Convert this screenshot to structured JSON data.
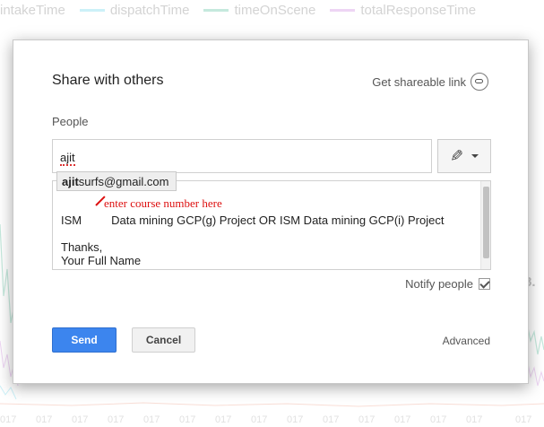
{
  "background": {
    "legend": [
      {
        "label": "intakeTime",
        "color": "#9e9e9e"
      },
      {
        "label": "dispatchTime",
        "color": "#8fe0f0"
      },
      {
        "label": "timeOnScene",
        "color": "#7fcfb4"
      },
      {
        "label": "totalResponseTime",
        "color": "#d9a3e6"
      }
    ],
    "right_label": "8.",
    "x_tick_labels": [
      "017",
      "017",
      "017",
      "017",
      "017",
      "017",
      "017",
      "017",
      "017",
      "017",
      "017",
      "017",
      "017",
      "017",
      "017"
    ]
  },
  "dialog": {
    "title": "Share with others",
    "share_link_label": "Get shareable link",
    "people_label": "People",
    "people_input_value": "ajit",
    "suggestion": {
      "bold": "ajit",
      "rest": "surfs@gmail.com"
    },
    "annotation": "enter course number here",
    "message": {
      "line1_prefix": "ISM",
      "line1_rest": "Data mining GCP(g) Project OR ISM Data mining GCP(i) Project",
      "line2": "Thanks,",
      "line3": "Your Full Name"
    },
    "notify_label": "Notify people",
    "notify_checked": true,
    "send_label": "Send",
    "cancel_label": "Cancel",
    "advanced_label": "Advanced"
  },
  "colors": {
    "send_button": "#3c85ee",
    "annotation": "#dd1111"
  }
}
